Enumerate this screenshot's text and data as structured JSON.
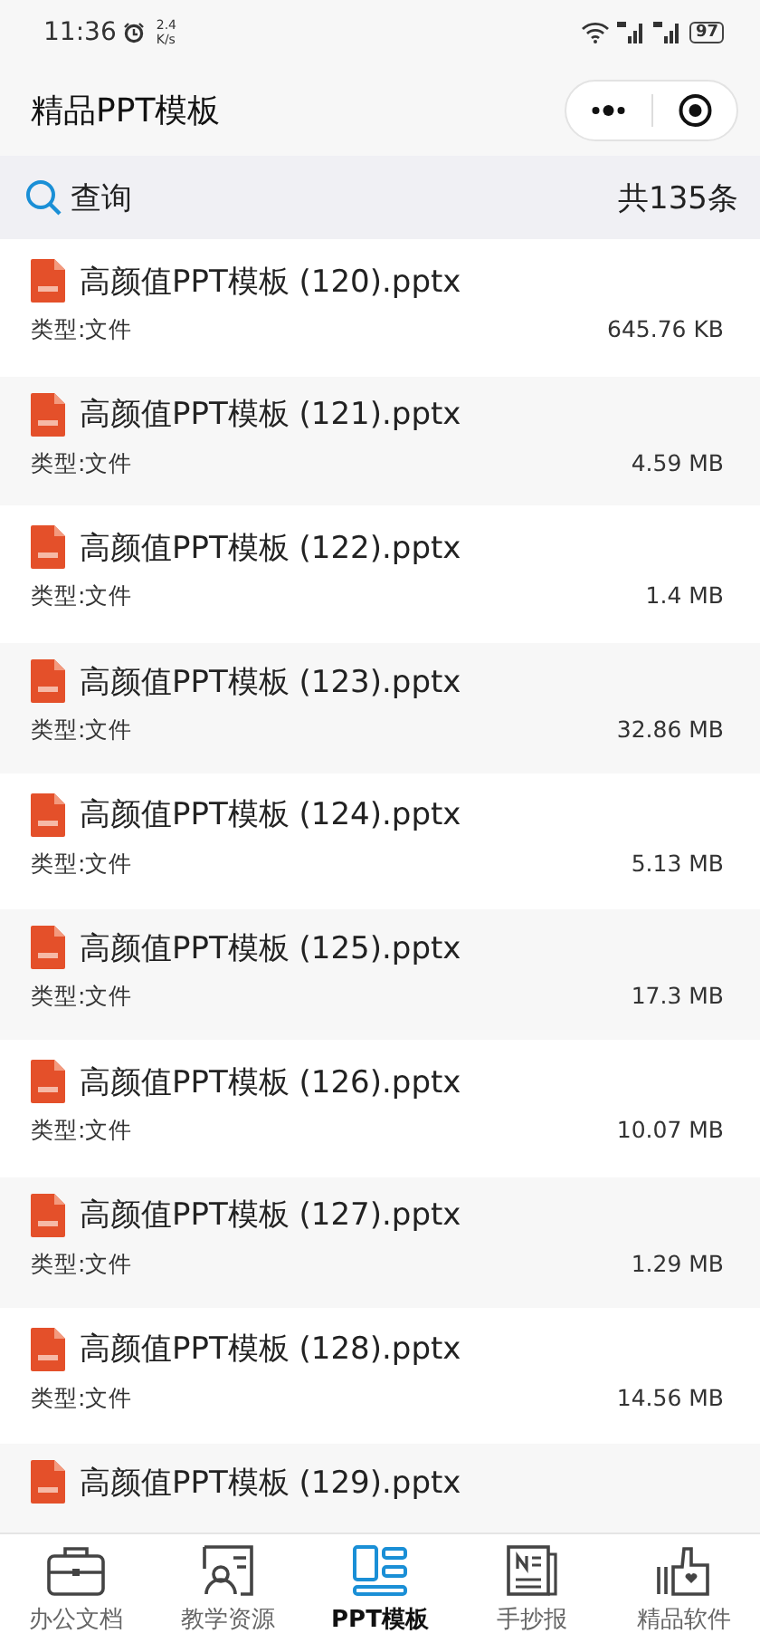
{
  "status_bar": {
    "time": "11:36",
    "speed_value": "2.4",
    "speed_unit": "K/s",
    "battery": "97"
  },
  "header": {
    "title": "精品PPT模板"
  },
  "search": {
    "label": "查询",
    "count": "共135条"
  },
  "files": [
    {
      "name": "高颜值PPT模板 (120).pptx",
      "type": "类型:文件",
      "size": "645.76 KB"
    },
    {
      "name": "高颜值PPT模板 (121).pptx",
      "type": "类型:文件",
      "size": "4.59 MB"
    },
    {
      "name": "高颜值PPT模板 (122).pptx",
      "type": "类型:文件",
      "size": "1.4 MB"
    },
    {
      "name": "高颜值PPT模板 (123).pptx",
      "type": "类型:文件",
      "size": "32.86 MB"
    },
    {
      "name": "高颜值PPT模板 (124).pptx",
      "type": "类型:文件",
      "size": "5.13 MB"
    },
    {
      "name": "高颜值PPT模板 (125).pptx",
      "type": "类型:文件",
      "size": "17.3 MB"
    },
    {
      "name": "高颜值PPT模板 (126).pptx",
      "type": "类型:文件",
      "size": "10.07 MB"
    },
    {
      "name": "高颜值PPT模板 (127).pptx",
      "type": "类型:文件",
      "size": "1.29 MB"
    },
    {
      "name": "高颜值PPT模板 (128).pptx",
      "type": "类型:文件",
      "size": "14.56 MB"
    },
    {
      "name": "高颜值PPT模板 (129).pptx"
    }
  ],
  "tabs": [
    {
      "label": "办公文档",
      "selected": false
    },
    {
      "label": "教学资源",
      "selected": false
    },
    {
      "label": "PPT模板",
      "selected": true
    },
    {
      "label": "手抄报",
      "selected": false
    },
    {
      "label": "精品软件",
      "selected": false
    }
  ]
}
